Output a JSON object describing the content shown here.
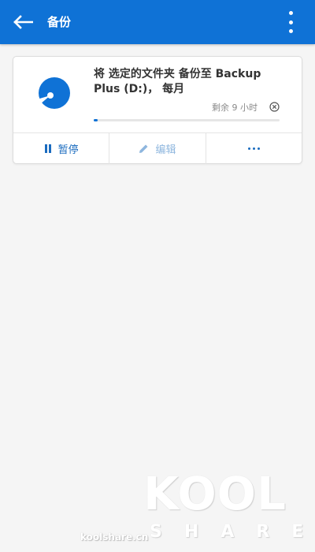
{
  "app_bar": {
    "title": "备份",
    "back_icon": "back-arrow-icon",
    "more_icon": "more-vertical-icon",
    "color": "#0f72d6"
  },
  "backup_card": {
    "icon": "disc-icon",
    "description": "将 选定的文件夹 备份至 Backup Plus (D:)， 每月",
    "remaining": "剩余 9 小时",
    "cancel_icon": "cancel-circle-icon",
    "progress_fraction": 0.02,
    "actions": {
      "pause_label": "暂停",
      "pause_icon": "pause-icon",
      "edit_label": "编辑",
      "edit_icon": "pencil-icon",
      "more_icon": "more-horizontal-icon"
    }
  },
  "watermark": {
    "logo": "KOOL",
    "sub": "SHARE",
    "site": "koolshare.cn"
  }
}
